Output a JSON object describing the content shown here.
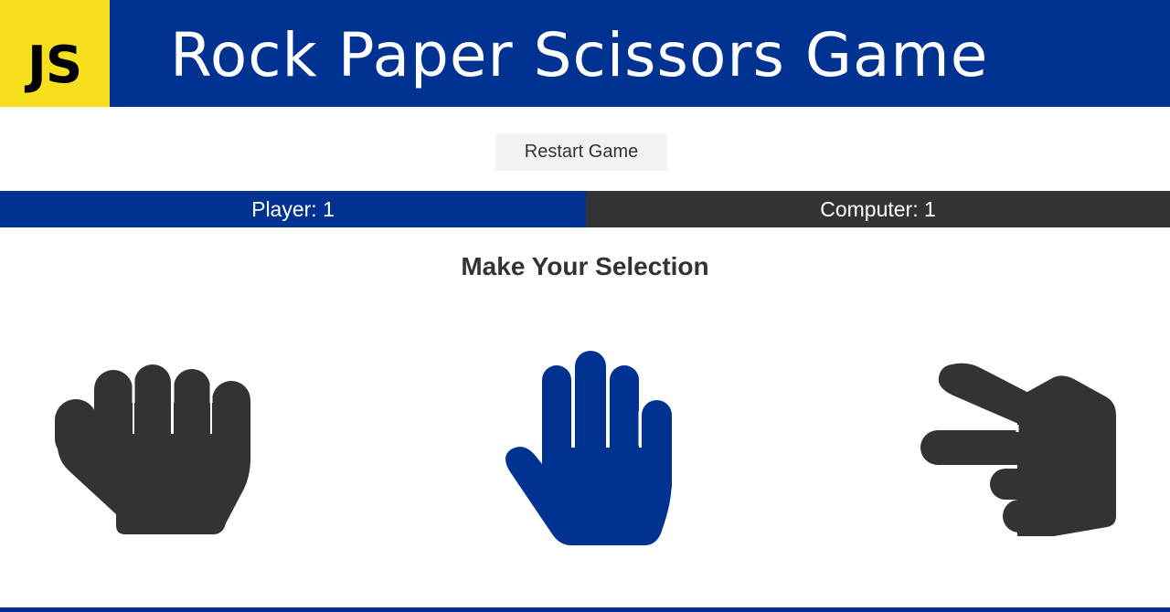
{
  "header": {
    "logo_text": "JS",
    "title": "Rock Paper Scissors Game"
  },
  "controls": {
    "restart_label": "Restart Game"
  },
  "score": {
    "player_label": "Player: 1",
    "computer_label": "Computer: 1",
    "player": 1,
    "computer": 1
  },
  "game": {
    "instruction": "Make Your Selection",
    "choices": [
      {
        "name": "rock",
        "icon": "hand-rock-icon",
        "color": "#333333"
      },
      {
        "name": "paper",
        "icon": "hand-paper-icon",
        "color": "#003391",
        "selected": true
      },
      {
        "name": "scissors",
        "icon": "hand-scissors-icon",
        "color": "#333333"
      }
    ]
  },
  "colors": {
    "primary": "#003391",
    "dark": "#333333",
    "js_yellow": "#f7df1e"
  }
}
